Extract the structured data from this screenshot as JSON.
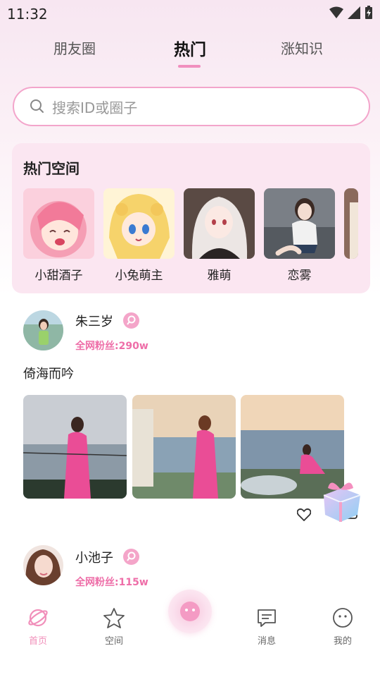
{
  "status_bar": {
    "time": "11:32"
  },
  "tabs": [
    {
      "label": "朋友圈"
    },
    {
      "label": "热门"
    },
    {
      "label": "涨知识"
    }
  ],
  "search": {
    "placeholder": "搜索ID或圈子"
  },
  "hot_spaces": {
    "title": "热门空间",
    "items": [
      {
        "name": "小甜酒子"
      },
      {
        "name": "小兔萌主"
      },
      {
        "name": "雅萌"
      },
      {
        "name": "恋雾"
      }
    ]
  },
  "posts": [
    {
      "username": "朱三岁",
      "fans": "全网粉丝:290w",
      "text": "倚海而吟"
    },
    {
      "username": "小池子",
      "fans": "全网粉丝:115w"
    }
  ],
  "nav": {
    "items": [
      {
        "label": "首页"
      },
      {
        "label": "空间"
      },
      {
        "label": "消息"
      },
      {
        "label": "我的"
      }
    ]
  },
  "colors": {
    "accent": "#f08fbe",
    "fans_text": "#ee6ea8"
  }
}
